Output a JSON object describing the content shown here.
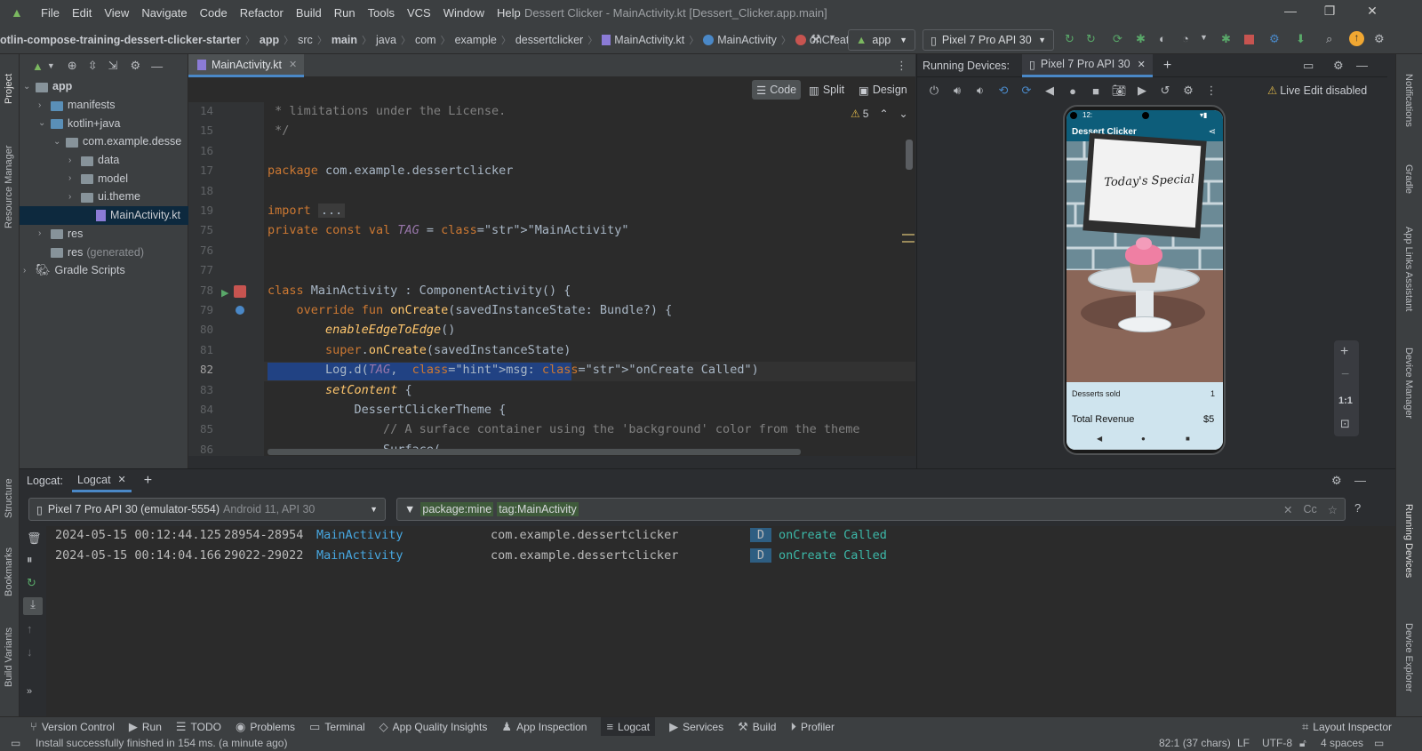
{
  "window": {
    "menu": [
      "File",
      "Edit",
      "View",
      "Navigate",
      "Code",
      "Refactor",
      "Build",
      "Run",
      "Tools",
      "VCS",
      "Window",
      "Help"
    ],
    "title": "Dessert Clicker - MainActivity.kt [Dessert_Clicker.app.main]"
  },
  "breadcrumbs": [
    "otlin-compose-training-dessert-clicker-starter",
    "app",
    "src",
    "main",
    "java",
    "com",
    "example",
    "dessertclicker",
    "MainActivity.kt",
    "MainActivity",
    "onCreate"
  ],
  "run_config": "app",
  "device_selector": "Pixel 7 Pro API 30",
  "project_tree": [
    {
      "label": "app",
      "indent": 0,
      "expanded": true,
      "icon": "folder"
    },
    {
      "label": "manifests",
      "indent": 1,
      "expanded": false,
      "icon": "folder-blue"
    },
    {
      "label": "kotlin+java",
      "indent": 1,
      "expanded": true,
      "icon": "folder-blue"
    },
    {
      "label": "com.example.desse",
      "indent": 2,
      "expanded": true,
      "icon": "folder"
    },
    {
      "label": "data",
      "indent": 3,
      "expanded": false,
      "icon": "folder"
    },
    {
      "label": "model",
      "indent": 3,
      "expanded": false,
      "icon": "folder"
    },
    {
      "label": "ui.theme",
      "indent": 3,
      "expanded": false,
      "icon": "folder"
    },
    {
      "label": "MainActivity.kt",
      "indent": 4,
      "expanded": null,
      "icon": "kotlin-file",
      "selected": true
    },
    {
      "label": "res",
      "indent": 1,
      "expanded": false,
      "icon": "folder"
    },
    {
      "label": "res",
      "suffix": "(generated)",
      "indent": 1,
      "expanded": null,
      "icon": "folder"
    },
    {
      "label": "Gradle Scripts",
      "indent": 0,
      "expanded": false,
      "icon": "gradle-icon"
    }
  ],
  "editor": {
    "tab": "MainActivity.kt",
    "view_modes": [
      "Code",
      "Split",
      "Design"
    ],
    "warnings": "5",
    "lines": [
      {
        "n": "14",
        "text": " * limitations under the License."
      },
      {
        "n": "15",
        "text": " */"
      },
      {
        "n": "16",
        "text": ""
      },
      {
        "n": "17",
        "text": "package com.example.dessertclicker"
      },
      {
        "n": "18",
        "text": ""
      },
      {
        "n": "19",
        "text": "import ..."
      },
      {
        "n": "75",
        "text": "private const val TAG = \"MainActivity\""
      },
      {
        "n": "76",
        "text": ""
      },
      {
        "n": "77",
        "text": ""
      },
      {
        "n": "78",
        "text": "class MainActivity : ComponentActivity() {"
      },
      {
        "n": "79",
        "text": "    override fun onCreate(savedInstanceState: Bundle?) {"
      },
      {
        "n": "80",
        "text": "        enableEdgeToEdge()"
      },
      {
        "n": "81",
        "text": "        super.onCreate(savedInstanceState)"
      },
      {
        "n": "82",
        "text": "        Log.d(TAG,  msg: \"onCreate Called\")"
      },
      {
        "n": "83",
        "text": "        setContent {"
      },
      {
        "n": "84",
        "text": "            DessertClickerTheme {"
      },
      {
        "n": "85",
        "text": "                // A surface container using the 'background' color from the theme"
      },
      {
        "n": "86",
        "text": "                Surface("
      }
    ]
  },
  "running_devices": {
    "title": "Running Devices:",
    "tab": "Pixel 7 Pro API 30",
    "live_edit": "Live Edit disabled",
    "zoom_label": "1:1"
  },
  "app_screen": {
    "status_time": "12:",
    "app_title": "Dessert Clicker",
    "sign_text": "Today's Special",
    "desserts_sold_label": "Desserts sold",
    "desserts_sold_value": "1",
    "revenue_label": "Total Revenue",
    "revenue_value": "$5"
  },
  "logcat": {
    "label": "Logcat:",
    "tab": "Logcat",
    "device": "Pixel 7 Pro API 30 (emulator-5554)",
    "device_suffix": "Android 11, API 30",
    "filter_package": "package:mine",
    "filter_tag": "tag:MainActivity",
    "entries": [
      {
        "time": "2024-05-15 00:12:44.125",
        "pid": "28954-28954",
        "tag": "MainActivity",
        "package": "com.example.dessertclicker",
        "level": "D",
        "message": "onCreate Called"
      },
      {
        "time": "2024-05-15 00:14:04.166",
        "pid": "29022-29022",
        "tag": "MainActivity",
        "package": "com.example.dessertclicker",
        "level": "D",
        "message": "onCreate Called"
      }
    ]
  },
  "left_tool_windows": [
    "Project",
    "Resource Manager",
    "Structure",
    "Bookmarks",
    "Build Variants"
  ],
  "right_tool_windows": [
    "Notifications",
    "Gradle",
    "App Links Assistant",
    "Device Manager",
    "Running Devices",
    "Device Explorer"
  ],
  "bottom_tool_windows": [
    "Version Control",
    "Run",
    "TODO",
    "Problems",
    "Terminal",
    "App Quality Insights",
    "App Inspection",
    "Logcat",
    "Services",
    "Build",
    "Profiler"
  ],
  "layout_inspector": "Layout Inspector",
  "status": {
    "message": "Install successfully finished in 154 ms. (a minute ago)",
    "position": "82:1 (37 chars)",
    "line_sep": "LF",
    "encoding": "UTF-8",
    "indent": "4 spaces"
  },
  "colors": {
    "accent": "#4a88c7",
    "run_green": "#59a869",
    "stop_red": "#c75450",
    "app_bar": "#0d5d7a"
  }
}
